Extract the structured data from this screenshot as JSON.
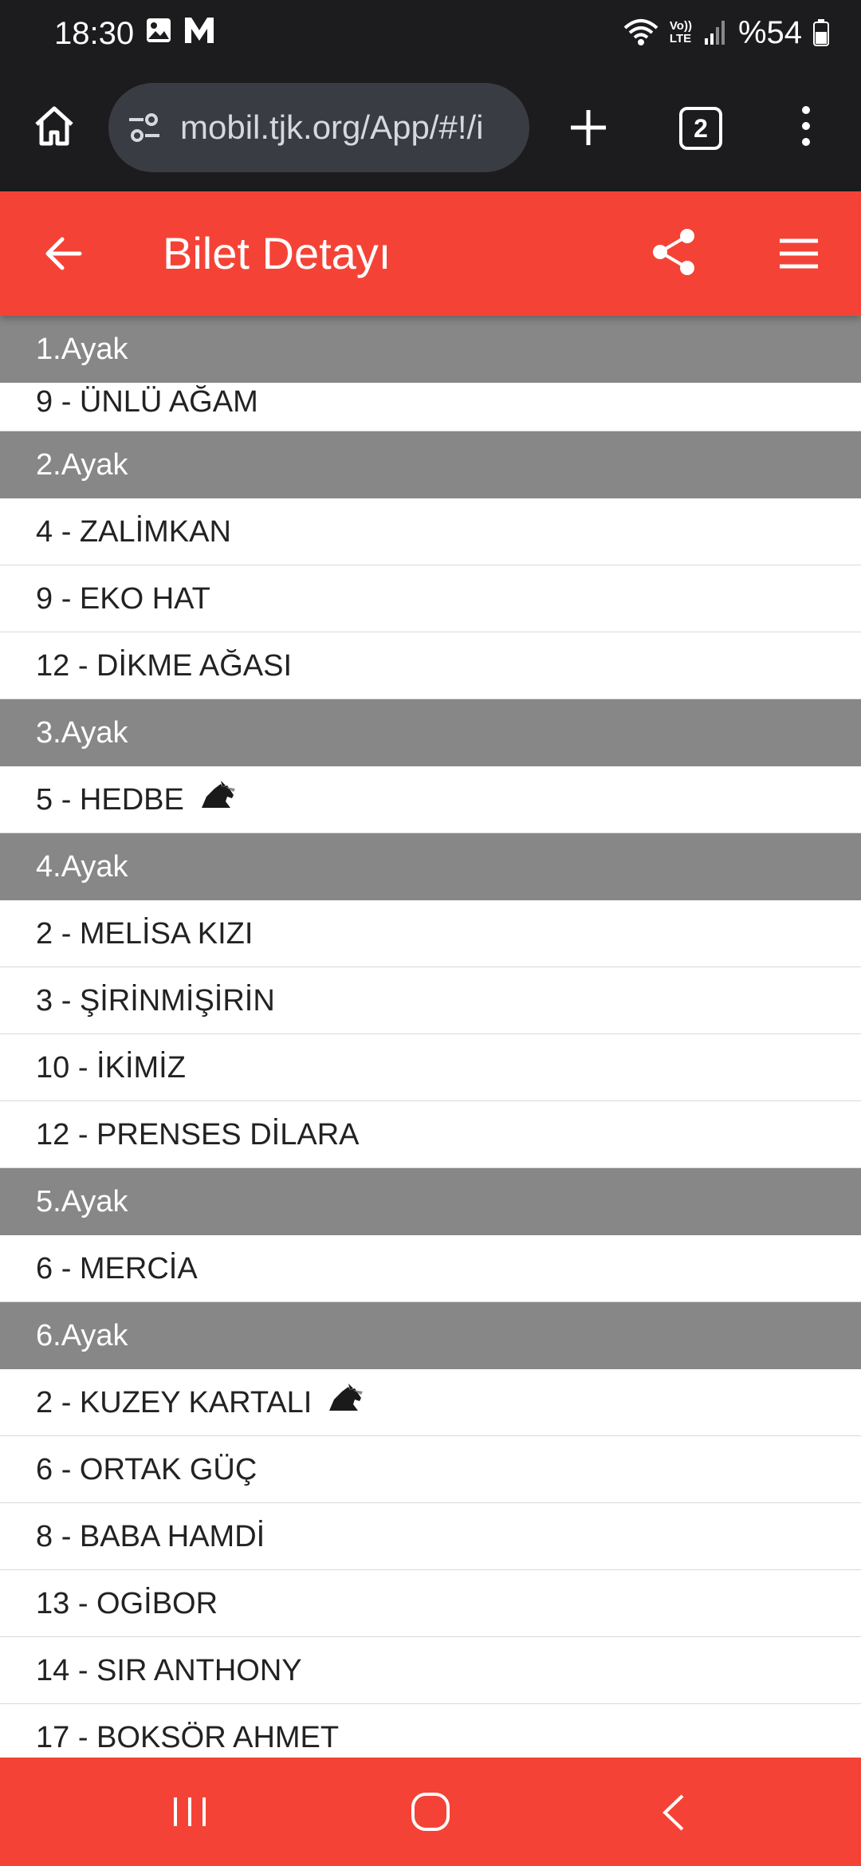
{
  "status_bar": {
    "time": "18:30",
    "left_icons": [
      "gallery-icon",
      "m-icon"
    ],
    "right_icons": [
      "wifi-icon",
      "volte-icon",
      "signal-icon",
      "battery-icon"
    ],
    "volte_label_top": "Vo))",
    "volte_label_bottom": "LTE",
    "battery_text": "%54"
  },
  "browser": {
    "url": "mobil.tjk.org/App/#!/i",
    "tab_count": "2",
    "icons": [
      "home-icon",
      "tune-icon",
      "plus-icon",
      "more-vert-icon"
    ]
  },
  "header": {
    "title": "Bilet Detayı",
    "background": "#f44336",
    "icons": [
      "arrow-back-icon",
      "share-icon",
      "hamburger-menu-icon"
    ]
  },
  "legs": [
    {
      "title": "1.Ayak",
      "entries": [
        {
          "label": "9 - ÜNLÜ AĞAM",
          "horse_icon": false
        }
      ]
    },
    {
      "title": "2.Ayak",
      "entries": [
        {
          "label": "4 - ZALİMKAN",
          "horse_icon": false
        },
        {
          "label": "9 - EKO HAT",
          "horse_icon": false
        },
        {
          "label": "12 - DİKME AĞASI",
          "horse_icon": false
        }
      ]
    },
    {
      "title": "3.Ayak",
      "entries": [
        {
          "label": "5 - HEDBE",
          "horse_icon": true
        }
      ]
    },
    {
      "title": "4.Ayak",
      "entries": [
        {
          "label": "2 - MELİSA KIZI",
          "horse_icon": false
        },
        {
          "label": "3 - ŞİRİNMİŞİRİN",
          "horse_icon": false
        },
        {
          "label": "10 - İKİMİZ",
          "horse_icon": false
        },
        {
          "label": "12 - PRENSES DİLARA",
          "horse_icon": false
        }
      ]
    },
    {
      "title": "5.Ayak",
      "entries": [
        {
          "label": "6 - MERCİA",
          "horse_icon": false
        }
      ]
    },
    {
      "title": "6.Ayak",
      "entries": [
        {
          "label": "2 - KUZEY KARTALI",
          "horse_icon": true
        },
        {
          "label": "6 - ORTAK GÜÇ",
          "horse_icon": false
        },
        {
          "label": "8 - BABA HAMDİ",
          "horse_icon": false
        },
        {
          "label": "13 - OGİBOR",
          "horse_icon": false
        },
        {
          "label": "14 - SIR ANTHONY",
          "horse_icon": false
        },
        {
          "label": "17 - BOKSÖR AHMET",
          "horse_icon": false
        }
      ]
    }
  ],
  "colors": {
    "leg_header_bg": "#878787",
    "accent": "#f44336",
    "browser_bg": "#1c1c1e"
  },
  "nav_bar": {
    "icons": [
      "recent-apps-icon",
      "home-circle-icon",
      "back-chevron-icon"
    ]
  }
}
